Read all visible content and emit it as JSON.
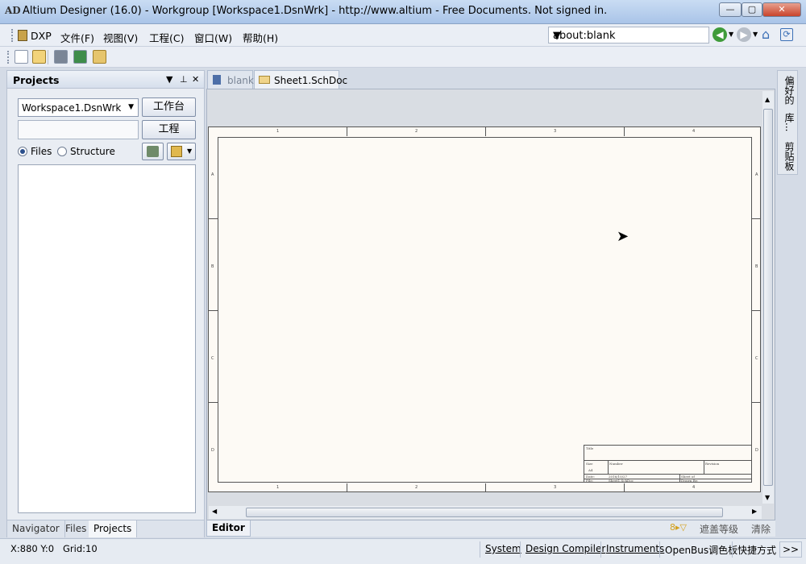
{
  "window": {
    "title": "Altium Designer (16.0) - Workgroup [Workspace1.DsnWrk] - http://www.altium - Free Documents. Not signed in.",
    "logo": "AD",
    "controls": [
      "—",
      "▢",
      "✕"
    ]
  },
  "menu": {
    "dxp": "DXP",
    "items": [
      "文件(F)",
      "视图(V)",
      "工程(C)",
      "窗口(W)",
      "帮助(H)"
    ],
    "address": "about:blank"
  },
  "toolbar": {
    "icons": [
      "new-document-icon",
      "open-folder-icon",
      "component-icon",
      "board-icon",
      "library-icon"
    ]
  },
  "projects_panel": {
    "title": "Projects",
    "workspace_select": "Workspace1.DsnWrk",
    "workbench_button": "工作台",
    "project_button": "工程",
    "radio_files": "Files",
    "radio_structure": "Structure",
    "tabs": [
      "Navigator",
      "Files",
      "Projects"
    ]
  },
  "document_tabs": [
    "blank",
    "Sheet1.SchDoc"
  ],
  "sheet": {
    "top_zones": [
      "1",
      "2",
      "3",
      "4"
    ],
    "side_zones": [
      "A",
      "B",
      "C",
      "D"
    ],
    "titleblock": {
      "title": "Title",
      "size": "Size",
      "size_value": "A4",
      "number": "Number",
      "revision": "Revision",
      "date": "Date:",
      "date_value": "2016/10/27",
      "file": "File:",
      "file_value": "Sheet1.SchDoc",
      "sheet": "Sheet    of",
      "drawn_by": "Drawn By:"
    }
  },
  "editor": {
    "tab_label": "Editor",
    "mask_level": "遮盖等级",
    "clear": "清除"
  },
  "right_dock": [
    "偏好的",
    "库...",
    "剪贴板"
  ],
  "statusbar": {
    "coords": "X:880 Y:0",
    "grid": "Grid:10",
    "buttons": [
      "System",
      "Design Compiler",
      "Instruments",
      "OpenBus调色板",
      "快捷方式"
    ],
    "more": ">>"
  },
  "colors": {
    "sheet": "#fdfaf5",
    "panel": "#e9edf3",
    "titlebar": "#a9c4e8"
  }
}
